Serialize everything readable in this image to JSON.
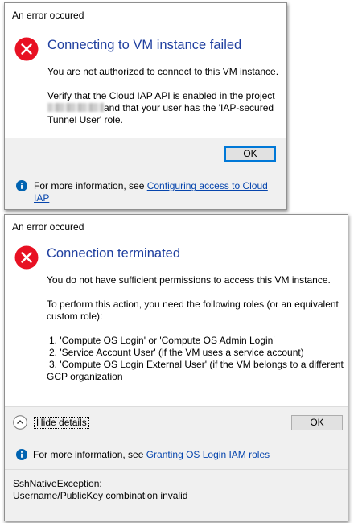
{
  "dialog1": {
    "title": "An error occured",
    "heading": "Connecting to VM instance failed",
    "message": "You are not authorized to connect to this VM instance.",
    "verify_line1": "Verify that the Cloud IAP API is enabled in the project",
    "verify_line2_suffix": "and that your user has the 'IAP-secured",
    "verify_line3": "Tunnel User' role.",
    "ok_label": "OK",
    "info_prefix": "For more information, see ",
    "info_link_line1": "Configuring access to Cloud",
    "info_link_line2": "IAP"
  },
  "dialog2": {
    "title": "An error occured",
    "heading": "Connection terminated",
    "message": "You do not have sufficient permissions to access this VM instance.",
    "roles_intro_line1": "To perform this action, you need the following roles (or an equivalent",
    "roles_intro_line2": "custom role):",
    "roles": [
      "1. 'Compute OS Login' or 'Compute OS Admin Login'",
      "2. 'Service Account User' (if the VM uses a service account)",
      "3. 'Compute OS Login External User' (if the VM belongs to a different",
      "GCP organization"
    ],
    "hide_details_label": "Hide details",
    "ok_label": "OK",
    "info_prefix": "For more information, see ",
    "info_link": "Granting OS Login IAM roles",
    "details_line1": "SshNativeException:",
    "details_line2": "Username/PublicKey combination invalid"
  },
  "colors": {
    "heading": "#1f3f9f",
    "error_icon": "#e81123",
    "info_icon": "#0063b1",
    "link": "#0645ad",
    "focus_border": "#0078d7"
  },
  "icons": {
    "error": "error-icon",
    "info": "info-icon",
    "chevron": "chevron-up-icon"
  }
}
